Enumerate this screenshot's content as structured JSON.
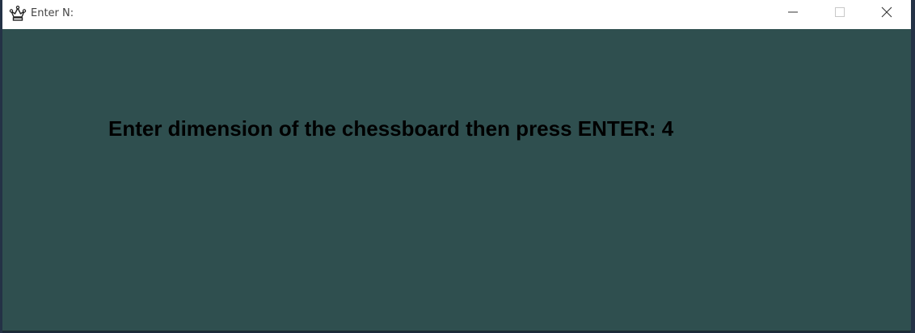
{
  "window": {
    "title": "Enter N:",
    "icon": "crown-icon",
    "background_color": "#2f4f4f",
    "controls": [
      "minimize-icon",
      "maximize-icon",
      "close-icon"
    ]
  },
  "main": {
    "prompt_text": "Enter dimension of the chessboard then press ENTER: 4"
  }
}
